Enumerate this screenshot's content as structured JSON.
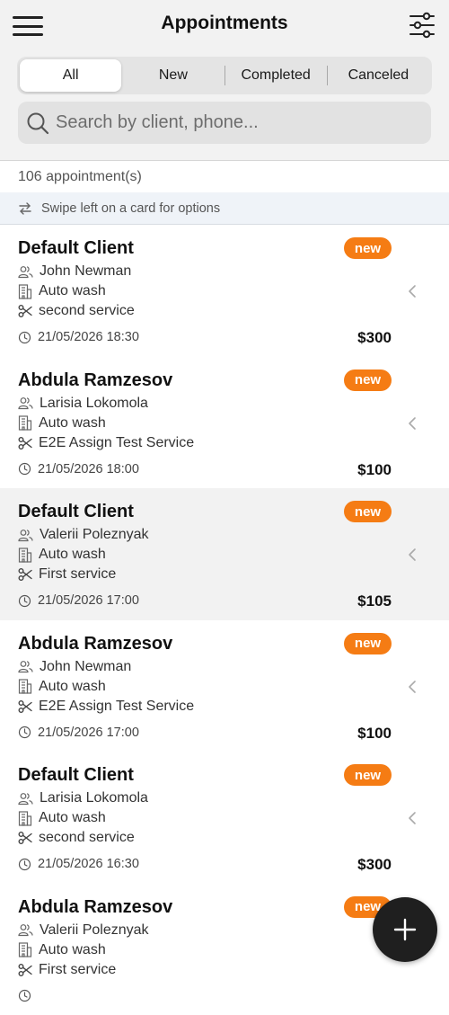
{
  "header": {
    "title": "Appointments",
    "menu_icon": "hamburger-icon",
    "filter_icon": "sliders-icon"
  },
  "tabs": [
    {
      "label": "All",
      "active": true
    },
    {
      "label": "New",
      "active": false
    },
    {
      "label": "Completed",
      "active": false
    },
    {
      "label": "Canceled",
      "active": false
    }
  ],
  "search": {
    "placeholder": "Search by client, phone...",
    "value": ""
  },
  "summary": {
    "count_text": "106 appointment(s)",
    "hint_text": "Swipe left on a card for options"
  },
  "appointments": [
    {
      "client": "Default Client",
      "staff": "John Newman",
      "location": "Auto wash",
      "service": "second service",
      "datetime": "21/05/2026 18:30",
      "price": "$300",
      "status": "new"
    },
    {
      "client": "Abdula Ramzesov",
      "staff": "Larisia Lokomola",
      "location": "Auto wash",
      "service": "E2E Assign Test Service",
      "datetime": "21/05/2026 18:00",
      "price": "$100",
      "status": "new"
    },
    {
      "client": "Default Client",
      "staff": "Valerii Poleznyak",
      "location": "Auto wash",
      "service": "First service",
      "datetime": "21/05/2026 17:00",
      "price": "$105",
      "status": "new"
    },
    {
      "client": "Abdula Ramzesov",
      "staff": "John Newman",
      "location": "Auto wash",
      "service": "E2E Assign Test Service",
      "datetime": "21/05/2026 17:00",
      "price": "$100",
      "status": "new"
    },
    {
      "client": "Default Client",
      "staff": "Larisia Lokomola",
      "location": "Auto wash",
      "service": "second service",
      "datetime": "21/05/2026 16:30",
      "price": "$300",
      "status": "new"
    },
    {
      "client": "Abdula Ramzesov",
      "staff": "Valerii Poleznyak",
      "location": "Auto wash",
      "service": "First service",
      "datetime": "",
      "price": "",
      "status": "new"
    }
  ],
  "colors": {
    "accent": "#f57c14",
    "fab": "#1f1f1f",
    "header_bg": "#f2f2f2"
  },
  "fab": {
    "icon": "plus-icon"
  }
}
